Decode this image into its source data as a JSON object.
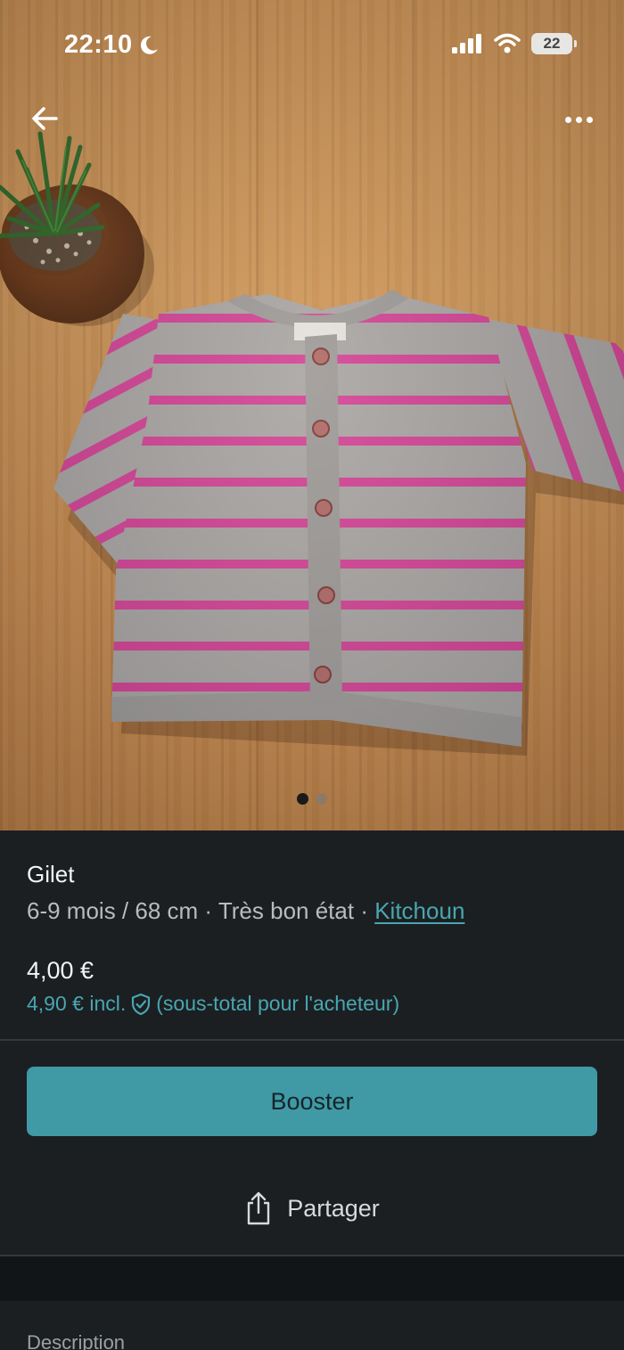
{
  "status_bar": {
    "time": "22:10",
    "battery": "22"
  },
  "gallery": {
    "total_photos": 2,
    "current_photo": 1,
    "subject": "striped-cardigan-photo"
  },
  "item": {
    "title": "Gilet",
    "size": "6-9 mois / 68 cm",
    "separator": "·",
    "condition": "Très bon état",
    "brand": "Kitchoun",
    "price": "4,00 €",
    "price_incl": "4,90 € incl.",
    "price_incl_note": "(sous-total pour l'acheteur)"
  },
  "actions": {
    "boost_label": "Booster",
    "share_label": "Partager"
  },
  "description": {
    "label": "Description"
  },
  "colors": {
    "accent": "#3f9aa5",
    "link": "#49a6b0",
    "background": "#1b1f22",
    "stripe_pink": "#d4439a",
    "knit_grey": "#a8a6a6"
  },
  "icons": {
    "back": "arrow-left-icon",
    "more": "more-horizontal-icon",
    "shield": "shield-check-icon",
    "share": "share-icon",
    "signal": "signal-icon",
    "wifi": "wifi-icon",
    "moon": "moon-icon"
  }
}
